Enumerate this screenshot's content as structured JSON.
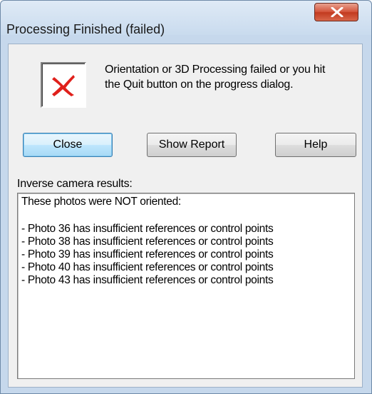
{
  "window": {
    "title": "Processing Finished (failed)"
  },
  "icons": {
    "close": "close-icon",
    "error": "error-x-icon"
  },
  "colors": {
    "error_red": "#e0201b",
    "default_button_border": "#3c7fb1",
    "close_button": "#c23a1f"
  },
  "message": {
    "line1": "Orientation or 3D Processing failed or you hit",
    "line2": "the Quit button on the progress dialog."
  },
  "buttons": {
    "close_label": "Close",
    "show_report_label": "Show Report",
    "help_label": "Help"
  },
  "results": {
    "label": "Inverse camera results:",
    "header": "These photos were NOT oriented:",
    "lines": [
      "- Photo 36 has insufficient references or control points",
      "- Photo 38 has insufficient references or control points",
      "- Photo 39 has insufficient references or control points",
      "- Photo 40 has insufficient references or control points",
      "- Photo 43 has insufficient references or control points"
    ]
  }
}
